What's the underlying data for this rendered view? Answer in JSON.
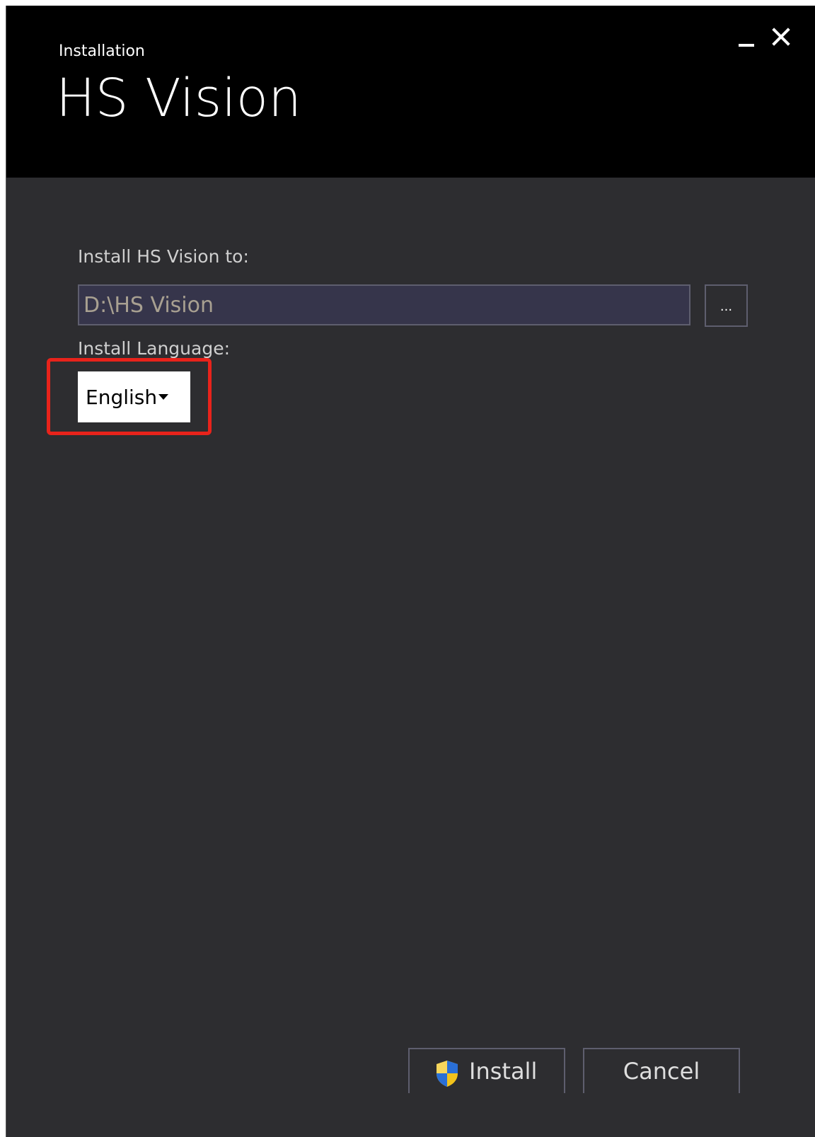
{
  "header": {
    "subtitle": "Installation",
    "title": "HS Vision"
  },
  "window_controls": {
    "minimize_icon": "minimize-icon",
    "close_icon": "close-icon"
  },
  "install_path": {
    "label": "Install HS Vision to:",
    "value": "D:\\HS Vision",
    "browse_label": "..."
  },
  "language": {
    "label": "Install Language:",
    "selected": "English"
  },
  "actions": {
    "install_label": "Install",
    "cancel_label": "Cancel"
  },
  "colors": {
    "header_bg": "#000000",
    "body_bg": "#2d2d30",
    "input_bg": "#36354b",
    "highlight": "#e8231b"
  }
}
